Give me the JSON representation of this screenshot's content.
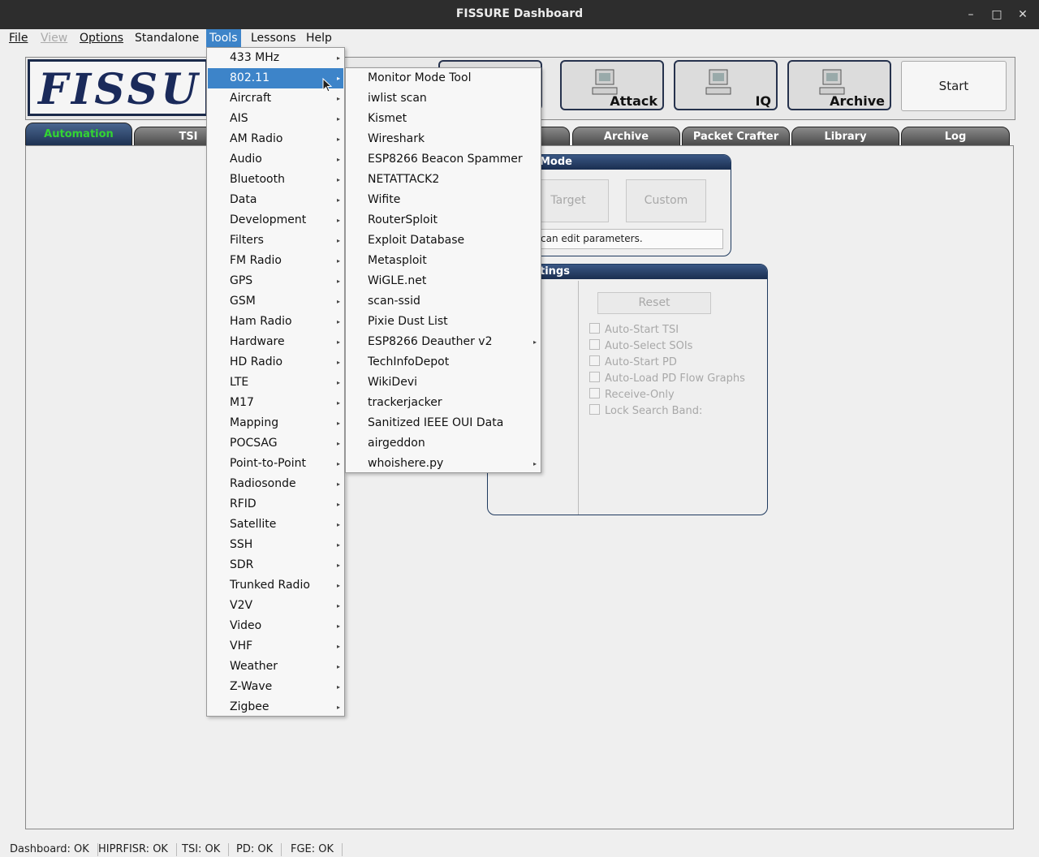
{
  "window": {
    "title": "FISSURE Dashboard"
  },
  "menubar": {
    "file": "File",
    "view": "View",
    "options": "Options",
    "standalone": "Standalone",
    "tools": "Tools",
    "lessons": "Lessons",
    "help": "Help"
  },
  "logo_text": "FISSU",
  "toolbar": {
    "attack": "Attack",
    "iq": "IQ",
    "archive": "Archive",
    "start": "Start",
    "pd_partial": "D"
  },
  "tabs": {
    "automation": "Automation",
    "tsi": "TSI",
    "archive": "Archive",
    "packet_crafter": "Packet Crafter",
    "library": "Library",
    "log": "Log"
  },
  "mode_group": {
    "title": "Mode",
    "target": "Target",
    "custom": "Custom",
    "description": "can edit parameters."
  },
  "settings_group": {
    "title": "tings",
    "reset": "Reset",
    "checks": [
      "Auto-Start TSI",
      "Auto-Select SOIs",
      "Auto-Start PD",
      "Auto-Load PD Flow Graphs",
      "Receive-Only",
      "Lock Search Band:"
    ]
  },
  "tools_menu": [
    "433 MHz",
    "802.11",
    "Aircraft",
    "AIS",
    "AM Radio",
    "Audio",
    "Bluetooth",
    "Data",
    "Development",
    "Filters",
    "FM Radio",
    "GPS",
    "GSM",
    "Ham Radio",
    "Hardware",
    "HD Radio",
    "LTE",
    "M17",
    "Mapping",
    "POCSAG",
    "Point-to-Point",
    "Radiosonde",
    "RFID",
    "Satellite",
    "SSH",
    "SDR",
    "Trunked Radio",
    "V2V",
    "Video",
    "VHF",
    "Weather",
    "Z-Wave",
    "Zigbee"
  ],
  "submenu_80211": [
    "Monitor Mode Tool",
    "iwlist scan",
    "Kismet",
    "Wireshark",
    "ESP8266 Beacon Spammer",
    "NETATTACK2",
    "Wifite",
    "RouterSploit",
    "Exploit Database",
    "Metasploit",
    "WiGLE.net",
    "scan-ssid",
    "Pixie Dust List",
    "ESP8266 Deauther v2",
    "TechInfoDepot",
    "WikiDevi",
    "trackerjacker",
    "Sanitized IEEE OUI Data",
    "airgeddon",
    "whoishere.py"
  ],
  "status": {
    "dashboard": "Dashboard: OK",
    "hiprfisr": "HIPRFISR: OK",
    "tsi": "TSI: OK",
    "pd": "PD: OK",
    "fge": "FGE: OK"
  },
  "colors": {
    "menu_highlight": "#3d84c9",
    "tab_active_text": "#33d433",
    "group_header": "#1f3a5f"
  }
}
